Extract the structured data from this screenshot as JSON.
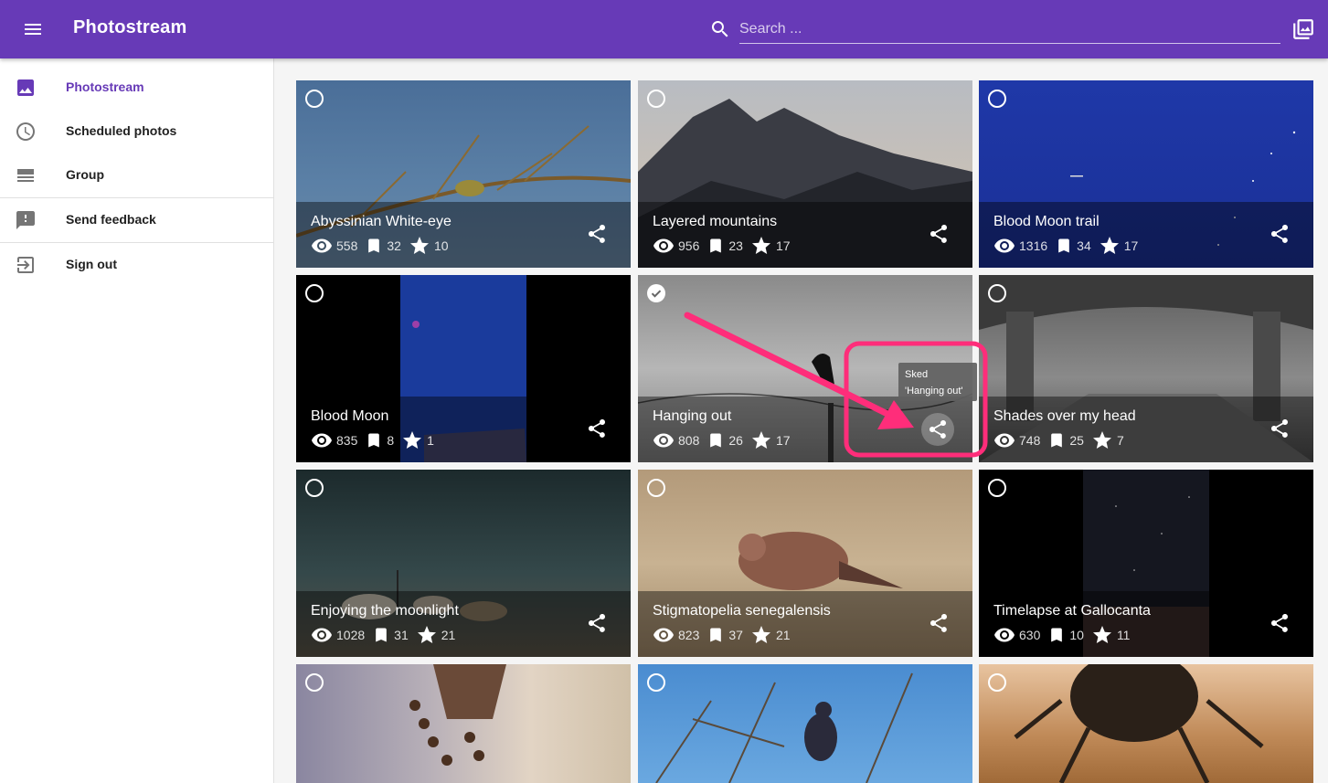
{
  "app": {
    "title": "Photostream"
  },
  "search": {
    "placeholder": "Search ..."
  },
  "colors": {
    "primary": "#673ab7",
    "annotation": "#ff2d7a"
  },
  "sidebar": {
    "items": [
      {
        "label": "Photostream",
        "icon": "image-icon",
        "active": true
      },
      {
        "label": "Scheduled photos",
        "icon": "clock-icon"
      },
      {
        "label": "Group",
        "icon": "view-stream-icon"
      },
      {
        "label": "Send feedback",
        "icon": "feedback-icon"
      },
      {
        "label": "Sign out",
        "icon": "exit-icon"
      }
    ]
  },
  "photos": [
    {
      "title": "Abyssinian White-eye",
      "views": "558",
      "bookmarks": "32",
      "stars": "10",
      "selected": false
    },
    {
      "title": "Layered mountains",
      "views": "956",
      "bookmarks": "23",
      "stars": "17",
      "selected": false
    },
    {
      "title": "Blood Moon trail",
      "views": "1316",
      "bookmarks": "34",
      "stars": "17",
      "selected": false
    },
    {
      "title": "Blood Moon",
      "views": "835",
      "bookmarks": "8",
      "stars": "1",
      "selected": false
    },
    {
      "title": "Hanging out",
      "views": "808",
      "bookmarks": "26",
      "stars": "17",
      "selected": true
    },
    {
      "title": "Shades over my head",
      "views": "748",
      "bookmarks": "25",
      "stars": "7",
      "selected": false
    },
    {
      "title": "Enjoying the moonlight",
      "views": "1028",
      "bookmarks": "31",
      "stars": "21",
      "selected": false
    },
    {
      "title": "Stigmatopelia senegalensis",
      "views": "823",
      "bookmarks": "37",
      "stars": "21",
      "selected": false
    },
    {
      "title": "Timelapse at Gallocanta",
      "views": "630",
      "bookmarks": "10",
      "stars": "11",
      "selected": false
    },
    {
      "selected": false
    },
    {
      "selected": false
    },
    {
      "selected": false
    }
  ],
  "tooltip": {
    "line1": "Sked",
    "line2": "'Hanging out'"
  }
}
